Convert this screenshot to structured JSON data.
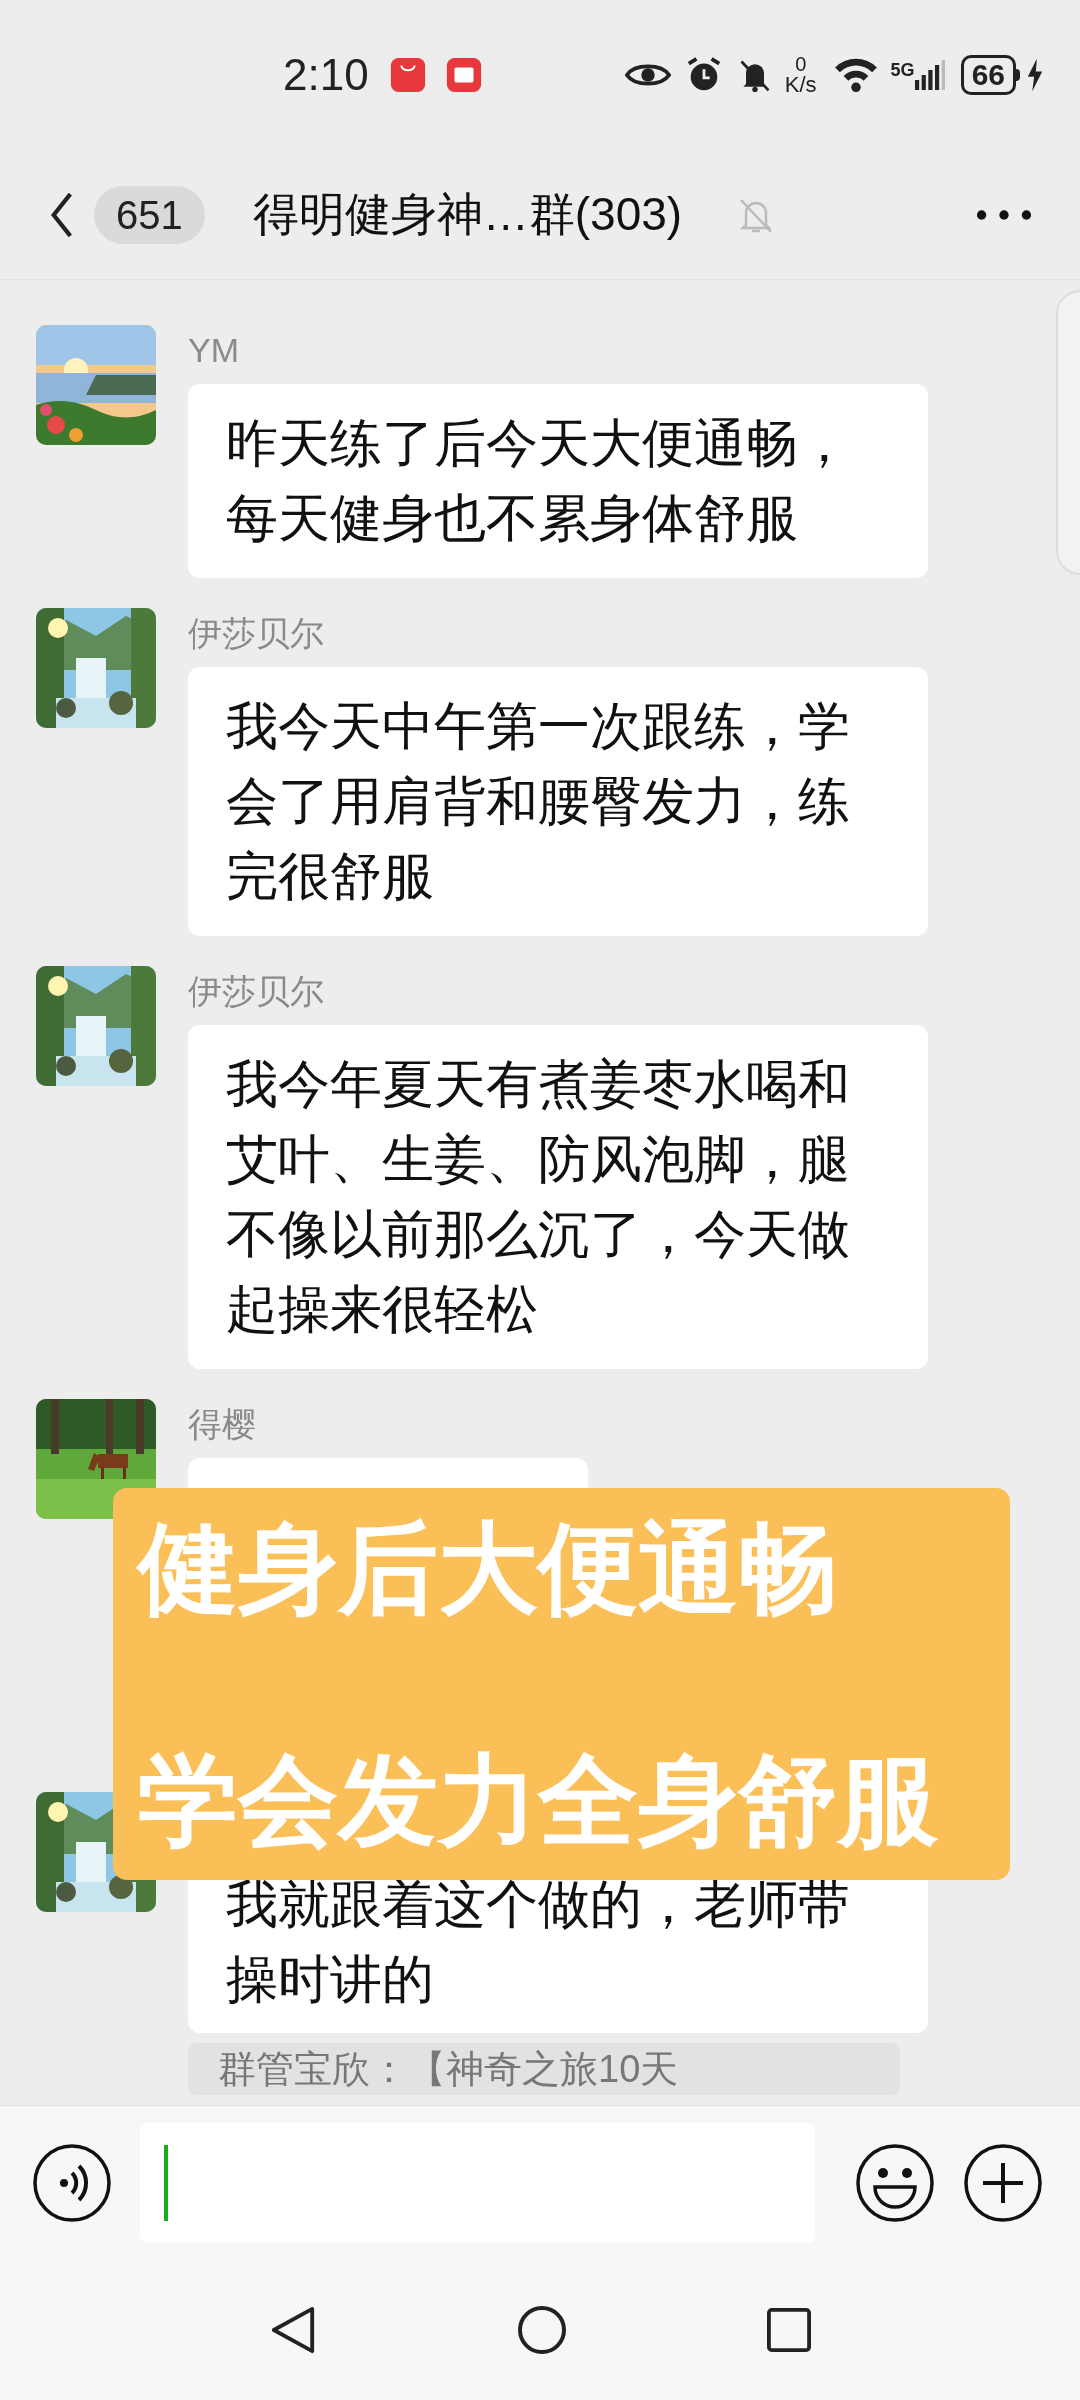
{
  "status_bar": {
    "time": "2:10",
    "speed_value": "0",
    "speed_unit": "K/s",
    "network": "5G",
    "battery": "66"
  },
  "header": {
    "unread_count": "651",
    "title": "得明健身神…群(303)",
    "muted": true
  },
  "messages": [
    {
      "sender": "YM",
      "text": "昨天练了后今天大便通畅，每天健身也不累身体舒服"
    },
    {
      "sender": "伊莎贝尔",
      "text": "我今天中午第一次跟练，学会了用肩背和腰臀发力，练完很舒服"
    },
    {
      "sender": "伊莎贝尔",
      "text": "我今年夏天有煮姜枣水喝和艾叶、生姜、防风泡脚，腿不像以前那么沉了，今天做起操来很轻松"
    },
    {
      "sender": "得樱",
      "kind": "covered"
    },
    {
      "text": "我就跟着这个做的，老师带操时讲的",
      "quote": "群管宝欣：【神奇之旅10天"
    }
  ],
  "overlay": {
    "lines": [
      "健身后大便通畅",
      "学会发力全身舒服"
    ]
  }
}
